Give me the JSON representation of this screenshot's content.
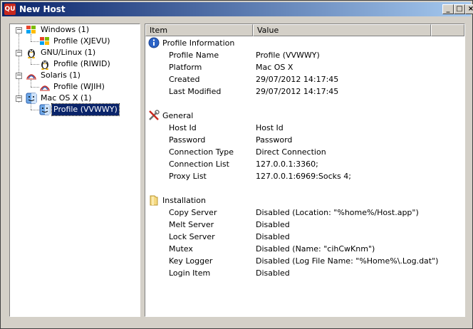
{
  "window": {
    "title": "New Host",
    "app_icon_text": "QU"
  },
  "title_buttons": {
    "minimize": "_",
    "maximize": "□",
    "close": "×"
  },
  "tree": {
    "expand_symbol": "−",
    "nodes": [
      {
        "label": "Windows (1)",
        "icon": "windows-flag-icon",
        "child": "Profile (XJEVU)"
      },
      {
        "label": "GNU/Linux (1)",
        "icon": "tux-penguin-icon",
        "child": "Profile (RIWID)"
      },
      {
        "label": "Solaris (1)",
        "icon": "solaris-sun-icon",
        "child": "Profile (WJIH)"
      },
      {
        "label": "Mac OS X (1)",
        "icon": "mac-finder-icon",
        "child": "Profile (VVWWY)"
      }
    ]
  },
  "list": {
    "headers": {
      "item": "Item",
      "value": "Value"
    },
    "sections": [
      {
        "title": "Profile Information",
        "icon": "info-icon",
        "rows": [
          {
            "item": "Profile Name",
            "value": "Profile (VVWWY)"
          },
          {
            "item": "Platform",
            "value": "Mac OS X"
          },
          {
            "item": "Created",
            "value": "29/07/2012 14:17:45"
          },
          {
            "item": "Last Modified",
            "value": "29/07/2012 14:17:45"
          }
        ]
      },
      {
        "title": "General",
        "icon": "tools-icon",
        "rows": [
          {
            "item": "Host Id",
            "value": "Host Id"
          },
          {
            "item": "Password",
            "value": "Password"
          },
          {
            "item": "Connection Type",
            "value": "Direct Connection"
          },
          {
            "item": "Connection List",
            "value": "127.0.0.1:3360;"
          },
          {
            "item": "Proxy List",
            "value": "127.0.0.1:6969:Socks 4;"
          }
        ]
      },
      {
        "title": "Installation",
        "icon": "folder-icon",
        "rows": [
          {
            "item": "Copy Server",
            "value": "Disabled (Location: \"%home%/Host.app\")"
          },
          {
            "item": "Melt Server",
            "value": "Disabled"
          },
          {
            "item": "Lock Server",
            "value": "Disabled"
          },
          {
            "item": "Mutex",
            "value": "Disabled (Name: \"cihCwKnm\")"
          },
          {
            "item": "Key Logger",
            "value": "Disabled (Log File Name: \"%Home%\\.Log.dat\")"
          },
          {
            "item": "Login Item",
            "value": "Disabled"
          }
        ]
      }
    ]
  }
}
